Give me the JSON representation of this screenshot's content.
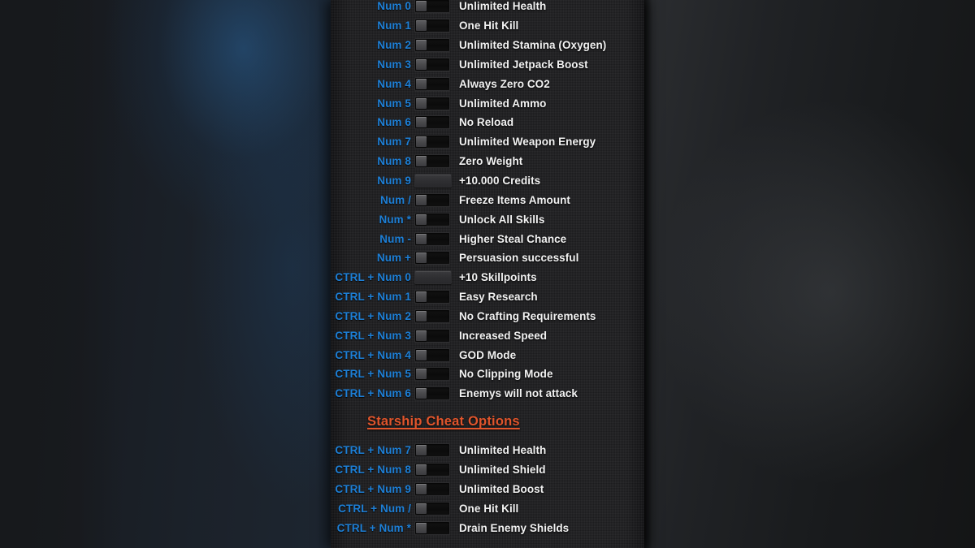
{
  "panel": {
    "background_color": "#1a1a1c",
    "hotkey_color": "#1d7fd6",
    "label_color": "#f2f2f2",
    "heading_color": "#e0552c"
  },
  "sections": [
    {
      "id": "general",
      "heading": null,
      "rows": [
        {
          "hotkey": "Num 0",
          "control": "toggle",
          "label": "Unlimited Health"
        },
        {
          "hotkey": "Num 1",
          "control": "toggle",
          "label": "One Hit Kill"
        },
        {
          "hotkey": "Num 2",
          "control": "toggle",
          "label": "Unlimited Stamina (Oxygen)"
        },
        {
          "hotkey": "Num 3",
          "control": "toggle",
          "label": "Unlimited Jetpack Boost"
        },
        {
          "hotkey": "Num 4",
          "control": "toggle",
          "label": "Always Zero CO2"
        },
        {
          "hotkey": "Num 5",
          "control": "toggle",
          "label": "Unlimited Ammo"
        },
        {
          "hotkey": "Num 6",
          "control": "toggle",
          "label": "No Reload"
        },
        {
          "hotkey": "Num 7",
          "control": "toggle",
          "label": "Unlimited Weapon Energy"
        },
        {
          "hotkey": "Num 8",
          "control": "toggle",
          "label": "Zero Weight"
        },
        {
          "hotkey": "Num 9",
          "control": "action",
          "label": "+10.000 Credits"
        },
        {
          "hotkey": "Num /",
          "control": "toggle",
          "label": "Freeze Items Amount"
        },
        {
          "hotkey": "Num *",
          "control": "toggle",
          "label": "Unlock All Skills"
        },
        {
          "hotkey": "Num -",
          "control": "toggle",
          "label": "Higher Steal Chance"
        },
        {
          "hotkey": "Num +",
          "control": "toggle",
          "label": "Persuasion successful"
        },
        {
          "hotkey": "CTRL + Num 0",
          "control": "action",
          "label": "+10 Skillpoints"
        },
        {
          "hotkey": "CTRL + Num 1",
          "control": "toggle",
          "label": "Easy Research"
        },
        {
          "hotkey": "CTRL + Num 2",
          "control": "toggle",
          "label": "No Crafting Requirements"
        },
        {
          "hotkey": "CTRL + Num 3",
          "control": "toggle",
          "label": "Increased Speed"
        },
        {
          "hotkey": "CTRL + Num 4",
          "control": "toggle",
          "label": "GOD Mode"
        },
        {
          "hotkey": "CTRL + Num 5",
          "control": "toggle",
          "label": "No Clipping Mode"
        },
        {
          "hotkey": "CTRL + Num 6",
          "control": "toggle",
          "label": "Enemys will not attack"
        }
      ]
    },
    {
      "id": "starship",
      "heading": "Starship Cheat Options",
      "rows": [
        {
          "hotkey": "CTRL + Num 7",
          "control": "toggle",
          "label": "Unlimited Health"
        },
        {
          "hotkey": "CTRL + Num 8",
          "control": "toggle",
          "label": "Unlimited Shield"
        },
        {
          "hotkey": "CTRL + Num 9",
          "control": "toggle",
          "label": "Unlimited Boost"
        },
        {
          "hotkey": "CTRL + Num /",
          "control": "toggle",
          "label": "One Hit Kill"
        },
        {
          "hotkey": "CTRL + Num *",
          "control": "toggle",
          "label": "Drain Enemy Shields"
        }
      ]
    }
  ]
}
